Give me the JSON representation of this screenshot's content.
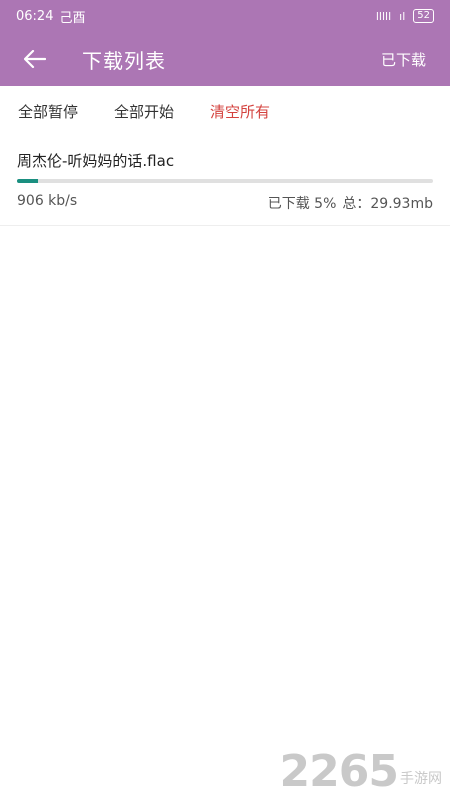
{
  "status_bar": {
    "time": "06:24",
    "extra": "己酉",
    "signal": "lllll",
    "network": "ıl",
    "battery": "52"
  },
  "app_bar": {
    "back_icon": "arrow-left-icon",
    "title": "下载列表",
    "action": "已下载"
  },
  "toolbar": {
    "pause_all": "全部暂停",
    "start_all": "全部开始",
    "clear_all": "清空所有"
  },
  "downloads": [
    {
      "name": "周杰伦-听妈妈的话.flac",
      "progress": 0.05,
      "speed": "906 kb/s",
      "downloaded_label": "已下载 5%",
      "total_label": "总：29.93mb"
    }
  ],
  "watermark": {
    "number": "2265",
    "text": "手游网"
  },
  "colors": {
    "primary": "#ac76b4",
    "progress": "#1a8f80",
    "danger": "#d4433f"
  }
}
